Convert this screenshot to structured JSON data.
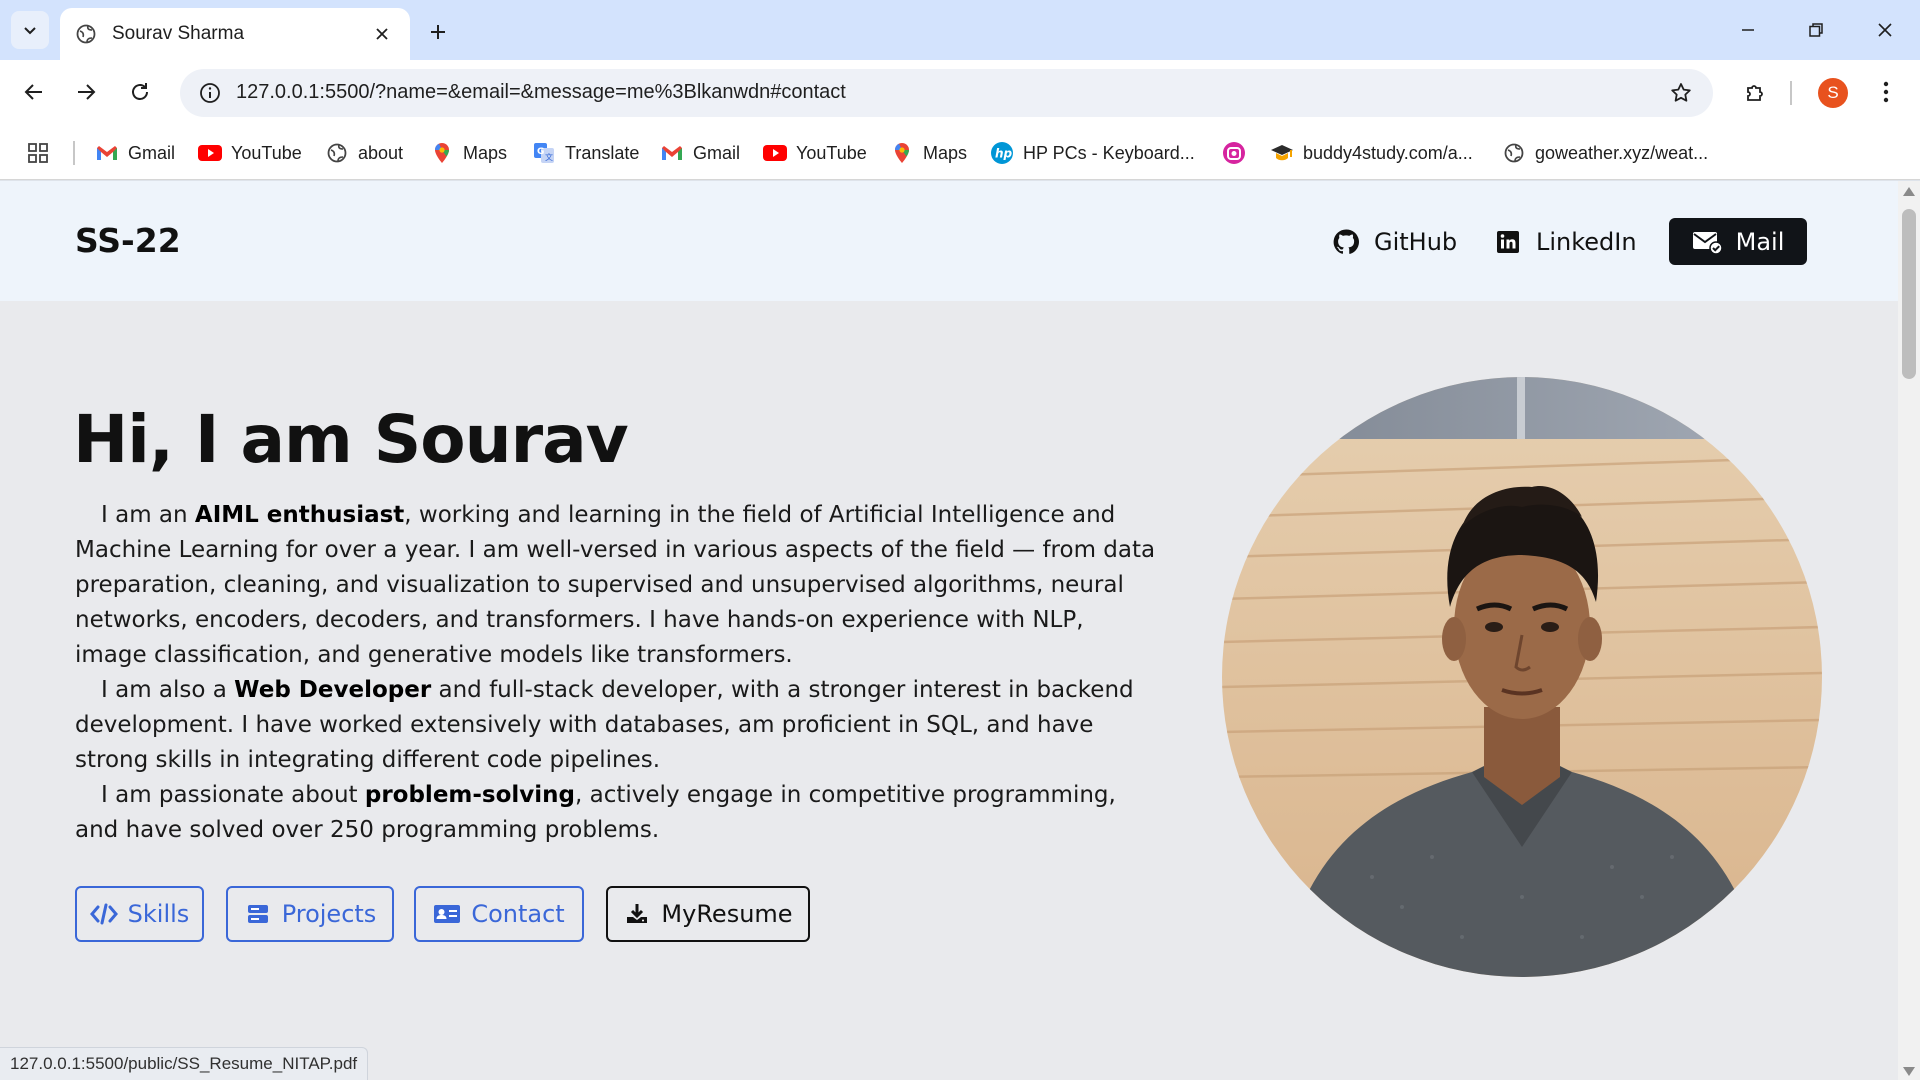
{
  "browser": {
    "tab": {
      "title": "Sourav Sharma"
    },
    "address_bar": {
      "url": "127.0.0.1:5500/?name=&email=&message=me%3Blkanwdn#contact"
    },
    "profile_initial": "S",
    "bookmarks": [
      {
        "label": "Gmail",
        "icon": "gmail-icon"
      },
      {
        "label": "YouTube",
        "icon": "youtube-icon"
      },
      {
        "label": "about",
        "icon": "globe-icon"
      },
      {
        "label": "Maps",
        "icon": "maps-icon"
      },
      {
        "label": "Translate",
        "icon": "translate-icon"
      },
      {
        "label": "Gmail",
        "icon": "gmail-icon"
      },
      {
        "label": "YouTube",
        "icon": "youtube-icon"
      },
      {
        "label": "Maps",
        "icon": "maps-icon"
      },
      {
        "label": "HP PCs - Keyboard...",
        "icon": "hp-icon"
      },
      {
        "label": "",
        "icon": "app-icon"
      },
      {
        "label": "buddy4study.com/a...",
        "icon": "graduation-icon"
      },
      {
        "label": "goweather.xyz/weat...",
        "icon": "globe-icon"
      }
    ],
    "status_url": "127.0.0.1:5500/public/SS_Resume_NITAP.pdf"
  },
  "site": {
    "logo": "SS-22",
    "nav": {
      "github": "GitHub",
      "linkedin": "LinkedIn",
      "mail": "Mail"
    },
    "hero": {
      "title": "Hi, I am Sourav",
      "p1": {
        "t1": "I am an ",
        "b1": "AIML enthusiast",
        "t2": ", working and learning in the field of Artificial Intelligence and Machine Learning for over a year. I am well-versed in various aspects of the field — from data preparation, cleaning, and visualization to supervised and unsupervised algorithms, neural networks, encoders, decoders, and transformers. I have hands-on experience with NLP, image classification, and generative models like transformers."
      },
      "p2": {
        "t1": "I am also a ",
        "b1": "Web Developer",
        "t2": " and full-stack developer, with a stronger interest in backend development. I have worked extensively with databases, am proficient in SQL, and have strong skills in integrating different code pipelines."
      },
      "p3": {
        "t1": "I am passionate about ",
        "b1": "problem-solving",
        "t2": ", actively engage in competitive programming, and have solved over 250 programming problems."
      }
    },
    "buttons": {
      "skills": "Skills",
      "projects": "Projects",
      "contact": "Contact",
      "resume": "MyResume"
    }
  },
  "colors": {
    "accent": "#3a67d8",
    "dark": "#111418",
    "header_bg": "#eef4fb",
    "page_bg": "#e9eaed"
  }
}
